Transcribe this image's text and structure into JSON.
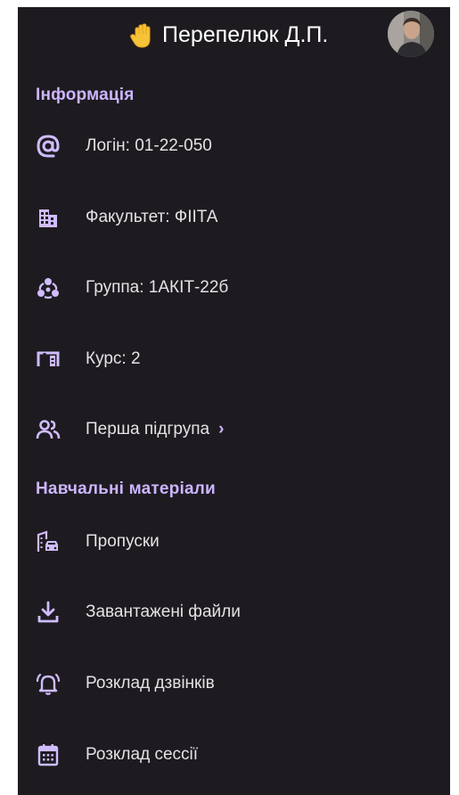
{
  "header": {
    "name": "Перепелюк Д.П.",
    "hand_icon": "raised-hand-emoji",
    "avatar_icon": "user-photo"
  },
  "info": {
    "title": "Інформація",
    "items": [
      {
        "icon": "at-icon",
        "label": "Логін: 01-22-050"
      },
      {
        "icon": "building-icon",
        "label": "Факультет: ФІІТА"
      },
      {
        "icon": "group-icon",
        "label": "Группа: 1АКІТ-22б"
      },
      {
        "icon": "course-icon",
        "label": "Курс: 2"
      },
      {
        "icon": "people-icon",
        "label": "Перша підгрупа",
        "chevron": "›"
      }
    ]
  },
  "materials": {
    "title": "Навчальні матеріали",
    "items": [
      {
        "icon": "absences-icon",
        "label": "Пропуски"
      },
      {
        "icon": "download-icon",
        "label": "Завантажені файли"
      },
      {
        "icon": "alarm-icon",
        "label": "Розклад дзвінків"
      },
      {
        "icon": "calendar-icon",
        "label": "Розклад сессії"
      }
    ]
  },
  "colors": {
    "background": "#1d1b20",
    "accent": "#cdb5ff",
    "icon": "#d0bcff",
    "text": "#e6e1e5"
  }
}
